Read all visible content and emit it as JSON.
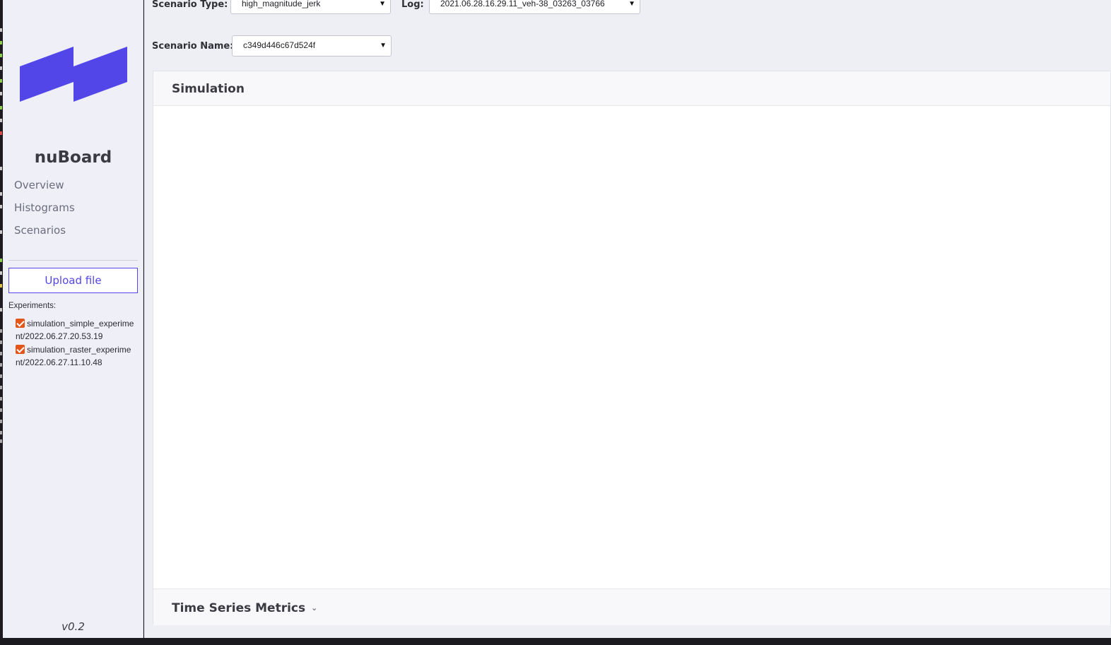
{
  "sidebar": {
    "brand": "nuBoard",
    "nav": [
      {
        "label": "Overview"
      },
      {
        "label": "Histograms"
      },
      {
        "label": "Scenarios"
      }
    ],
    "upload_label": "Upload file",
    "experiments_label": "Experiments:",
    "experiments": [
      {
        "label": "simulation_simple_experiment/2022.06.27.20.53.19",
        "checked": true
      },
      {
        "label": "simulation_raster_experiment/2022.06.27.11.10.48",
        "checked": true
      }
    ],
    "version": "v0.2"
  },
  "filters": {
    "scenario_type_label": "Scenario Type:",
    "scenario_type_value": "high_magnitude_jerk",
    "log_label": "Log:",
    "log_value": "2021.06.28.16.29.11_veh-38_03263_03766",
    "scenario_name_label": "Scenario Name:",
    "scenario_name_value": "c349d446c67d524f"
  },
  "panels": {
    "simulation_title": "Simulation",
    "time_series_title": "Time Series Metrics"
  },
  "colors": {
    "accent": "#5346e8",
    "checkbox": "#e2561c",
    "sidebar_bg": "#eeeff7"
  }
}
